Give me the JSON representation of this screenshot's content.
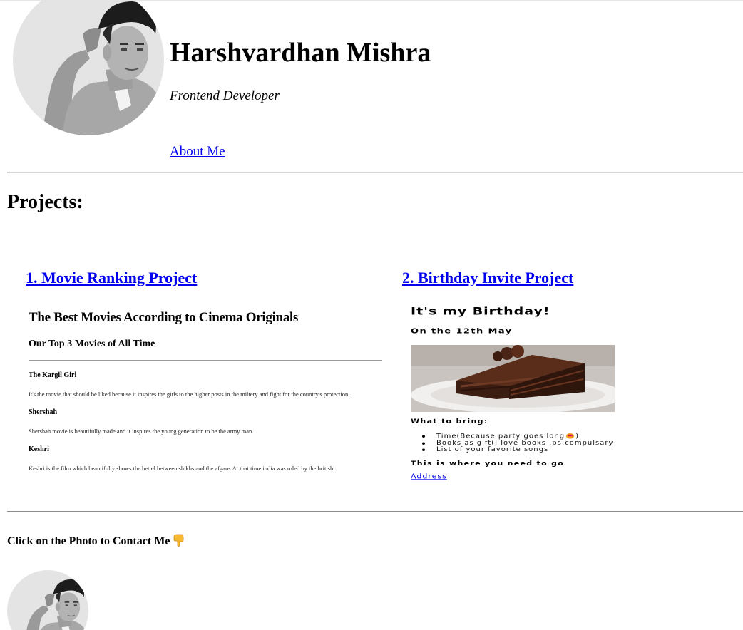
{
  "header": {
    "name": "Harshvardhan Mishra",
    "role": "Frontend Developer",
    "about_link": "About Me"
  },
  "projects": {
    "title": "Projects:",
    "items": [
      {
        "link": "1. Movie Ranking Project",
        "preview": {
          "heading": "The Best Movies According to Cinema Originals",
          "subheading": "Our Top 3 Movies of All Time",
          "movies": [
            {
              "title": "The Kargil Girl",
              "text": "It's the movie that should be liked because it inspires the girls to the higher posts in the miltery and fight for the country's protection."
            },
            {
              "title": "Shershah",
              "text": "Shershah movie is beautifully made and it inspires the young generation to be the army man."
            },
            {
              "title": "Keshri",
              "text": "Keshri is the film which beautifully shows the bettel between shikhs and the afgans.At that time india was ruled by the british."
            }
          ]
        }
      },
      {
        "link": "2. Birthday Invite Project",
        "preview": {
          "heading": "It's my Birthday!",
          "subheading": "On the 12th May",
          "bring_heading": "What to bring:",
          "bring_items": [
            "Time(Because party goes long",
            ")",
            "Books as gift(I love books .ps:compulsary",
            "List of your favorite songs"
          ],
          "where_heading": "This is where you need to go",
          "address_link": "Address"
        }
      }
    ]
  },
  "contact": {
    "text": "Click on the Photo to Contact Me"
  },
  "icons": {
    "hand": "pointing-down-hand-icon",
    "party_face": "grinning-face-icon"
  },
  "colors": {
    "link": "#0000ee",
    "rule": "#8a8a8a"
  }
}
